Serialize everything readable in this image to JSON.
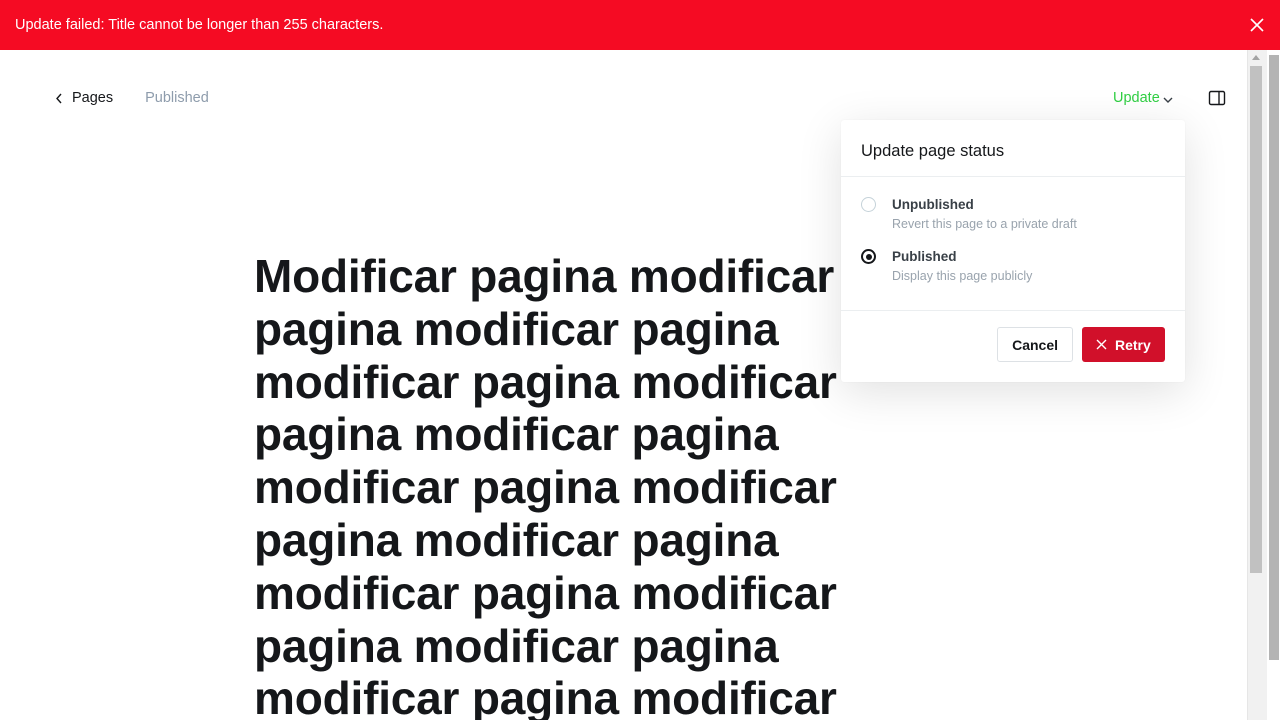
{
  "alert": {
    "message": "Update failed: Title cannot be longer than 255 characters.",
    "close_icon": "close-icon"
  },
  "topbar": {
    "back_label": "Pages",
    "status": "Published",
    "update_label": "Update",
    "settings_icon": "sidebar-toggle-icon"
  },
  "post": {
    "title": "Modificar pagina modificar pagina modificar pagina modificar pagina modificar pagina modificar pagina modificar pagina modificar pagina modificar pagina modificar pagina modificar pagina modificar pagina modificar pagina modificar"
  },
  "popup": {
    "title": "Update page status",
    "options": [
      {
        "label": "Unpublished",
        "description": "Revert this page to a private draft",
        "selected": false
      },
      {
        "label": "Published",
        "description": "Display this page publicly",
        "selected": true
      }
    ],
    "cancel_label": "Cancel",
    "retry_label": "Retry"
  },
  "colors": {
    "alert_bg": "#f50b23",
    "update_green": "#30cf43",
    "retry_red": "#d1102a"
  }
}
